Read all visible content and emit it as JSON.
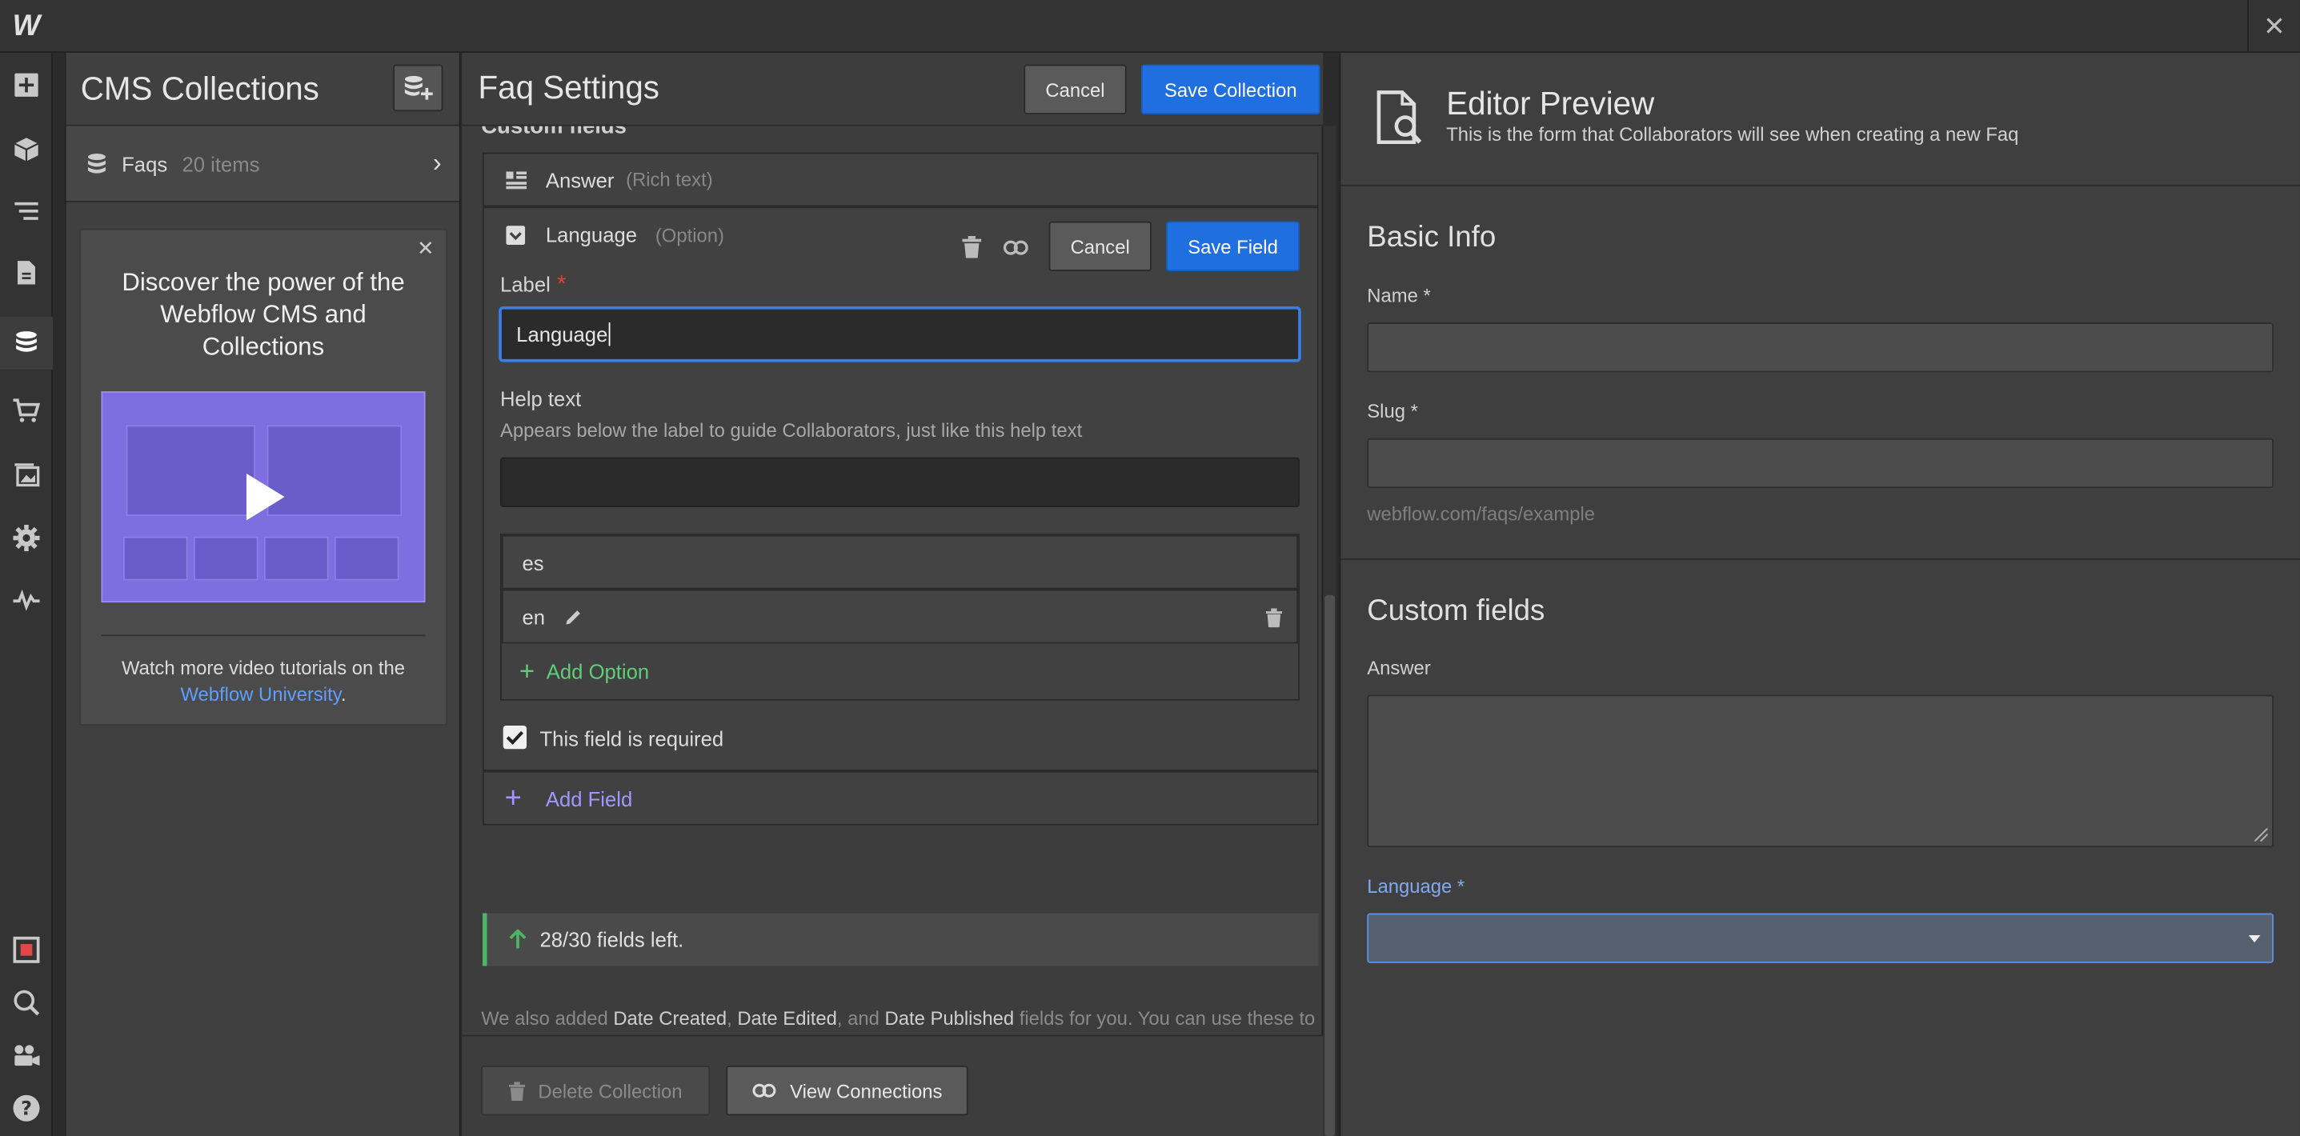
{
  "topbar": {
    "logo": "W",
    "close": "✕"
  },
  "rail": {
    "icons": [
      "add-icon",
      "box-icon",
      "navigator-icon",
      "pages-icon",
      "cms-icon",
      "ecommerce-icon",
      "assets-icon",
      "settings-icon",
      "audit-icon",
      "record-icon",
      "search-icon",
      "video-icon",
      "help-icon"
    ]
  },
  "cms": {
    "title": "CMS Collections",
    "collection": {
      "name": "Faqs",
      "count": "20 items"
    },
    "promo": {
      "title": "Discover the power of the Webflow CMS and Collections",
      "text_before": "Watch more video tutorials on the ",
      "link": "Webflow University",
      "text_after": "."
    }
  },
  "settings": {
    "title": "Faq Settings",
    "cancel": "Cancel",
    "save": "Save Collection",
    "section_cut": "Custom fields",
    "answer": {
      "name": "Answer",
      "type": "(Rich text)"
    },
    "language": {
      "name": "Language",
      "type": "(Option)",
      "cancel": "Cancel",
      "save": "Save Field",
      "label_label": "Label",
      "label_value": "Language",
      "help_label": "Help text",
      "help_desc": "Appears below the label to guide Collaborators, just like this help text",
      "help_value": "",
      "options": [
        "es",
        "en"
      ],
      "add_option": "Add Option",
      "required": "This field is required"
    },
    "add_field": "Add Field",
    "fields_left": "28/30 fields left.",
    "note": {
      "p1": "We also added ",
      "d1": "Date Created",
      "p2": ", ",
      "d2": "Date Edited",
      "p3": ", and ",
      "d3": "Date Published",
      "p4": " fields for you. You can use these to filter and sort Collection Lists in the Designer. These don't count against your field limit."
    },
    "delete": "Delete Collection",
    "connections": "View Connections"
  },
  "preview": {
    "title": "Editor Preview",
    "subtitle": "This is the form that Collaborators will see when creating a new Faq",
    "basic_info": "Basic Info",
    "name_label": "Name *",
    "slug_label": "Slug *",
    "slug_hint": "webflow.com/faqs/example",
    "custom_fields": "Custom fields",
    "answer_label": "Answer",
    "language_label": "Language *"
  },
  "colors": {
    "accent": "#1f6fe0",
    "success": "#4bb764",
    "required": "#e04040"
  }
}
